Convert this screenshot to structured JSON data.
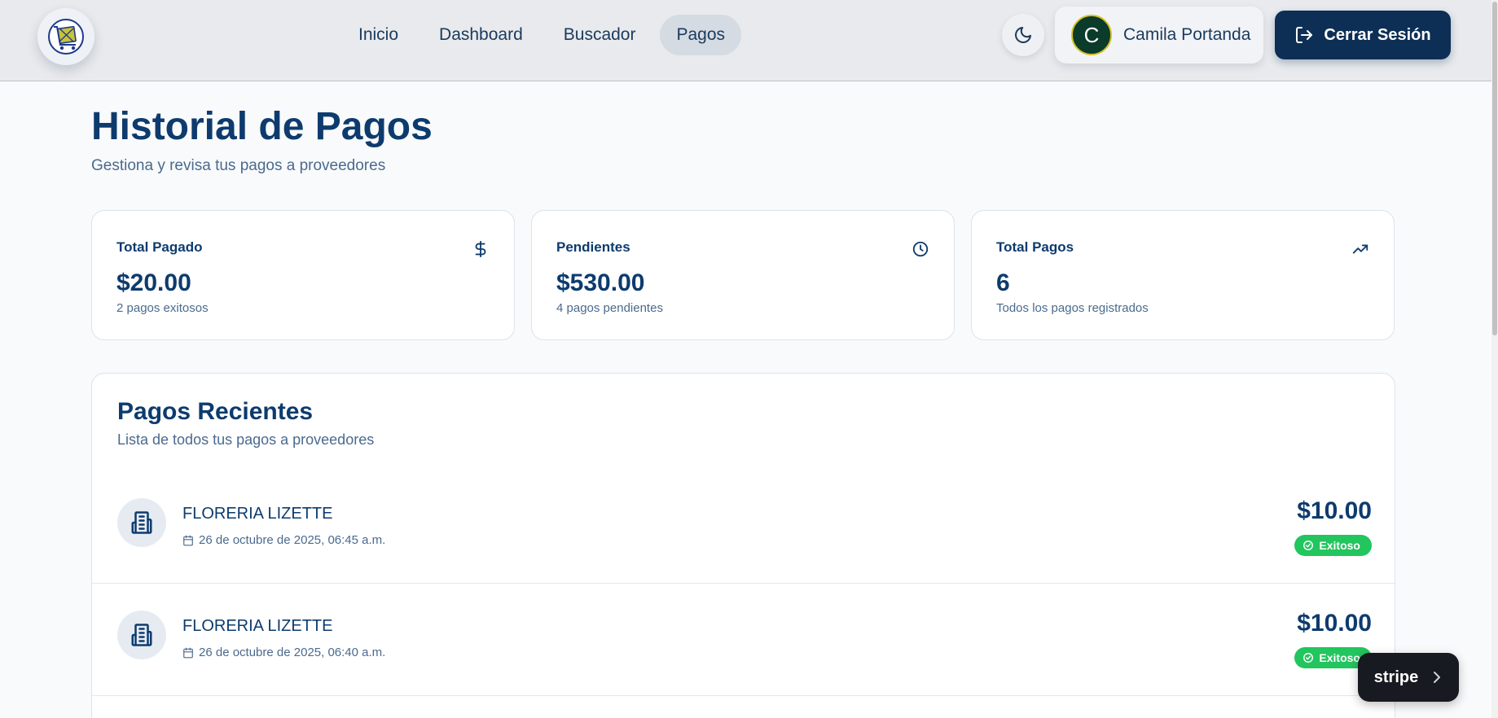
{
  "nav": {
    "logo_icon": "shopping-cart-logo-icon",
    "items": [
      {
        "label": "Inicio",
        "active": false
      },
      {
        "label": "Dashboard",
        "active": false
      },
      {
        "label": "Buscador",
        "active": false
      },
      {
        "label": "Pagos",
        "active": true
      }
    ],
    "theme_icon": "moon-icon",
    "user": {
      "initial": "C",
      "name": "Camila Portanda"
    },
    "logout_label": "Cerrar Sesión",
    "logout_icon": "logout-icon"
  },
  "header": {
    "title": "Historial de Pagos",
    "subtitle": "Gestiona y revisa tus pagos a proveedores"
  },
  "stats": [
    {
      "label": "Total Pagado",
      "value": "$20.00",
      "note": "2 pagos exitosos",
      "icon": "dollar-icon"
    },
    {
      "label": "Pendientes",
      "value": "$530.00",
      "note": "4 pagos pendientes",
      "icon": "clock-icon"
    },
    {
      "label": "Total Pagos",
      "value": "6",
      "note": "Todos los pagos registrados",
      "icon": "trending-up-icon"
    }
  ],
  "payments": {
    "title": "Pagos Recientes",
    "subtitle": "Lista de todos tus pagos a proveedores",
    "items": [
      {
        "vendor": "FLORERIA LIZETTE",
        "date": "26 de octubre de 2025, 06:45 a.m.",
        "amount": "$10.00",
        "status": "Exitoso"
      },
      {
        "vendor": "FLORERIA LIZETTE",
        "date": "26 de octubre de 2025, 06:40 a.m.",
        "amount": "$10.00",
        "status": "Exitoso"
      }
    ]
  },
  "stripe": {
    "label": "stripe"
  },
  "colors": {
    "primary": "#0d3b6e",
    "navy_button": "#0d2f55",
    "success": "#22c55e",
    "topbar": "#e8eaed",
    "stripe_bg": "#171a20"
  }
}
